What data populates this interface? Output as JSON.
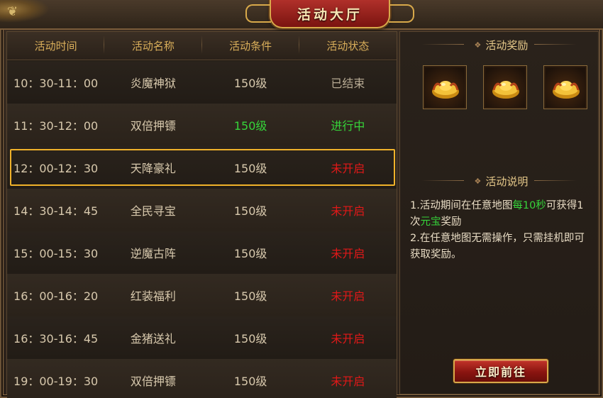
{
  "window": {
    "title": "活动大厅",
    "corner_glyph": "❦"
  },
  "table": {
    "headers": [
      "活动时间",
      "活动名称",
      "活动条件",
      "活动状态"
    ],
    "rows": [
      {
        "time": "10：30-11：00",
        "name": "炎魔神狱",
        "level": "150级",
        "status": "已结束",
        "status_type": "ended"
      },
      {
        "time": "11：30-12：00",
        "name": "双倍押镖",
        "level": "150级",
        "status": "进行中",
        "status_type": "live"
      },
      {
        "time": "12：00-12：30",
        "name": "天降豪礼",
        "level": "150级",
        "status": "未开启",
        "status_type": "not_started",
        "selected": true
      },
      {
        "time": "14：30-14：45",
        "name": "全民寻宝",
        "level": "150级",
        "status": "未开启",
        "status_type": "not_started"
      },
      {
        "time": "15：00-15：30",
        "name": "逆魔古阵",
        "level": "150级",
        "status": "未开启",
        "status_type": "not_started"
      },
      {
        "time": "16：00-16：20",
        "name": "红装福利",
        "level": "150级",
        "status": "未开启",
        "status_type": "not_started"
      },
      {
        "time": "16：30-16：45",
        "name": "金猪送礼",
        "level": "150级",
        "status": "未开启",
        "status_type": "not_started"
      },
      {
        "time": "19：00-19：30",
        "name": "双倍押镖",
        "level": "150级",
        "status": "未开启",
        "status_type": "not_started"
      }
    ]
  },
  "side": {
    "rewards_title": "活动奖励",
    "rewards": [
      {
        "icon": "gold-ingot-icon"
      },
      {
        "icon": "gold-ingot-icon"
      },
      {
        "icon": "gold-ingot-icon"
      }
    ],
    "desc_title": "活动说明",
    "desc": {
      "line1_a": "1.活动期间在任意地图",
      "line1_hl": "每10秒",
      "line1_b": "可获得1次",
      "line1_hl2": "元宝",
      "line1_c": "奖励",
      "line2": "2.在任意地图无需操作，只需挂机即可获取奖励。"
    },
    "go_button": "立即前往"
  },
  "colors": {
    "accent_gold": "#d9ae5a",
    "status_live": "#36d43a",
    "status_not_started": "#e01818",
    "status_ended": "#b7aa93",
    "selected_border": "#f0b22a"
  }
}
